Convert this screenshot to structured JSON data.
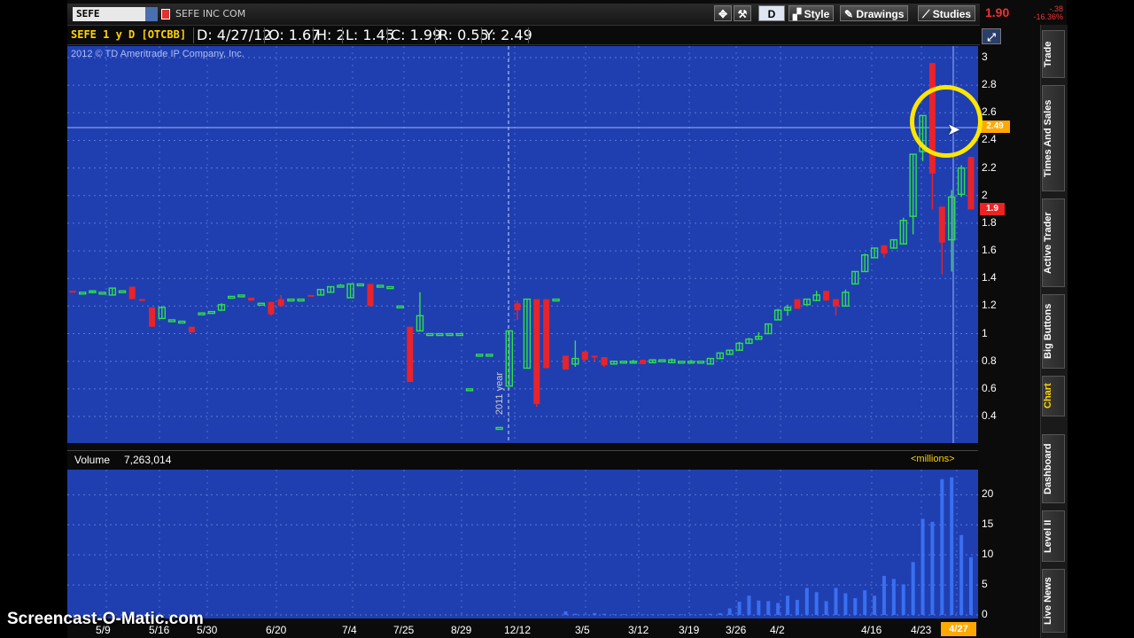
{
  "toolbar": {
    "symbol": "SEFE",
    "company": "SEFE INC COM",
    "period_button": "D",
    "style_label": "Style",
    "drawings_label": "Drawings",
    "studies_label": "Studies",
    "last_price": "1.90",
    "change_abs": "-.38",
    "change_pct": "-16.36%"
  },
  "infobar": {
    "title": "SEFE 1 y D [OTCBB]",
    "date": "D: 4/27/12",
    "open": "O: 1.67",
    "high": "H: 2",
    "low": "L: 1.45",
    "close": "C: 1.99",
    "range": "R: 0.55",
    "y": "Y: 2.49"
  },
  "copyright": "2012 © TD Ameritrade IP Company, Inc.",
  "year_marker": "2011 year",
  "price_tags": {
    "crosshair": "2.49",
    "last": "1.9"
  },
  "volume": {
    "label": "Volume",
    "value": "7,263,014",
    "units": "<millions>"
  },
  "sidebar": [
    "Trade",
    "Times And Sales",
    "Active Trader",
    "Big Buttons",
    "Chart",
    "Dashboard",
    "Level II",
    "Live News"
  ],
  "watermark": "Screencast-O-Matic.com",
  "colors": {
    "chart_bg": "#1f3fb0",
    "up": "#2fe04a",
    "down": "#e8232a",
    "accent": "#ffd400"
  },
  "chart_data": [
    {
      "type": "candlestick",
      "title": "",
      "y_ticks": [
        3,
        2.8,
        2.6,
        2.4,
        2.2,
        2,
        1.8,
        1.6,
        1.4,
        1.2,
        1,
        0.8,
        0.6,
        0.4
      ],
      "ylim": [
        0.28,
        3.08
      ],
      "x_ticks": [
        "5/9",
        "5/16",
        "5/30",
        "6/20",
        "7/4",
        "7/25",
        "8/29",
        "12/12",
        "3/5",
        "3/12",
        "3/19",
        "3/26",
        "4/2",
        "4/16",
        "4/23",
        "4/27"
      ],
      "candles": [
        {
          "o": 1.31,
          "h": 1.31,
          "l": 1.3,
          "c": 1.3
        },
        {
          "o": 1.3,
          "h": 1.3,
          "l": 1.3,
          "c": 1.3
        },
        {
          "o": 1.3,
          "h": 1.31,
          "l": 1.3,
          "c": 1.31
        },
        {
          "o": 1.3,
          "h": 1.3,
          "l": 1.3,
          "c": 1.3
        },
        {
          "o": 1.28,
          "h": 1.33,
          "l": 1.28,
          "c": 1.33
        },
        {
          "o": 1.31,
          "h": 1.31,
          "l": 1.31,
          "c": 1.31
        },
        {
          "o": 1.34,
          "h": 1.34,
          "l": 1.25,
          "c": 1.25
        },
        {
          "o": 1.25,
          "h": 1.25,
          "l": 1.24,
          "c": 1.24
        },
        {
          "o": 1.19,
          "h": 1.19,
          "l": 1.05,
          "c": 1.05
        },
        {
          "o": 1.11,
          "h": 1.2,
          "l": 1.11,
          "c": 1.19
        },
        {
          "o": 1.1,
          "h": 1.1,
          "l": 1.1,
          "c": 1.1
        },
        {
          "o": 1.09,
          "h": 1.09,
          "l": 1.09,
          "c": 1.09
        },
        {
          "o": 1.05,
          "h": 1.05,
          "l": 1.01,
          "c": 1.01
        },
        {
          "o": 1.15,
          "h": 1.15,
          "l": 1.15,
          "c": 1.15
        },
        {
          "o": 1.16,
          "h": 1.16,
          "l": 1.16,
          "c": 1.16
        },
        {
          "o": 1.17,
          "h": 1.22,
          "l": 1.17,
          "c": 1.21
        },
        {
          "o": 1.27,
          "h": 1.27,
          "l": 1.27,
          "c": 1.27
        },
        {
          "o": 1.28,
          "h": 1.28,
          "l": 1.28,
          "c": 1.28
        },
        {
          "o": 1.26,
          "h": 1.26,
          "l": 1.24,
          "c": 1.24
        },
        {
          "o": 1.22,
          "h": 1.22,
          "l": 1.22,
          "c": 1.22
        },
        {
          "o": 1.23,
          "h": 1.23,
          "l": 1.13,
          "c": 1.14
        },
        {
          "o": 1.25,
          "h": 1.28,
          "l": 1.2,
          "c": 1.2
        },
        {
          "o": 1.25,
          "h": 1.25,
          "l": 1.25,
          "c": 1.25
        },
        {
          "o": 1.25,
          "h": 1.25,
          "l": 1.25,
          "c": 1.25
        },
        {
          "o": 1.28,
          "h": 1.28,
          "l": 1.27,
          "c": 1.27
        },
        {
          "o": 1.28,
          "h": 1.32,
          "l": 1.28,
          "c": 1.32
        },
        {
          "o": 1.3,
          "h": 1.34,
          "l": 1.3,
          "c": 1.34
        },
        {
          "o": 1.35,
          "h": 1.36,
          "l": 1.35,
          "c": 1.35
        },
        {
          "o": 1.26,
          "h": 1.36,
          "l": 1.26,
          "c": 1.36
        },
        {
          "o": 1.36,
          "h": 1.36,
          "l": 1.36,
          "c": 1.36
        },
        {
          "o": 1.36,
          "h": 1.36,
          "l": 1.2,
          "c": 1.2
        },
        {
          "o": 1.35,
          "h": 1.35,
          "l": 1.35,
          "c": 1.35
        },
        {
          "o": 1.34,
          "h": 1.34,
          "l": 1.34,
          "c": 1.34
        },
        {
          "o": 1.2,
          "h": 1.2,
          "l": 1.2,
          "c": 1.2
        },
        {
          "o": 1.05,
          "h": 1.05,
          "l": 0.65,
          "c": 0.65
        },
        {
          "o": 1.02,
          "h": 1.3,
          "l": 1.02,
          "c": 1.13
        },
        {
          "o": 1.0,
          "h": 1.0,
          "l": 1.0,
          "c": 1.0
        },
        {
          "o": 1.0,
          "h": 1.0,
          "l": 1.0,
          "c": 1.0
        },
        {
          "o": 1.0,
          "h": 1.0,
          "l": 1.0,
          "c": 1.0
        },
        {
          "o": 1.0,
          "h": 1.0,
          "l": 1.0,
          "c": 1.0
        },
        {
          "o": 0.6,
          "h": 0.6,
          "l": 0.6,
          "c": 0.6
        },
        {
          "o": 0.85,
          "h": 0.85,
          "l": 0.85,
          "c": 0.85
        },
        {
          "o": 0.85,
          "h": 0.85,
          "l": 0.85,
          "c": 0.85
        },
        {
          "o": 0.32,
          "h": 0.32,
          "l": 0.32,
          "c": 0.32
        },
        {
          "o": 0.62,
          "h": 1.02,
          "l": 0.62,
          "c": 1.02
        },
        {
          "o": 1.22,
          "h": 1.24,
          "l": 1.1,
          "c": 1.17
        },
        {
          "o": 0.75,
          "h": 1.25,
          "l": 0.75,
          "c": 1.25
        },
        {
          "o": 1.25,
          "h": 1.25,
          "l": 0.47,
          "c": 0.49
        },
        {
          "o": 1.25,
          "h": 1.25,
          "l": 0.75,
          "c": 0.75
        },
        {
          "o": 1.25,
          "h": 1.25,
          "l": 1.25,
          "c": 1.25
        },
        {
          "o": 0.84,
          "h": 0.84,
          "l": 0.74,
          "c": 0.74
        },
        {
          "o": 0.78,
          "h": 0.95,
          "l": 0.76,
          "c": 0.82
        },
        {
          "o": 0.87,
          "h": 0.87,
          "l": 0.8,
          "c": 0.81
        },
        {
          "o": 0.84,
          "h": 0.84,
          "l": 0.8,
          "c": 0.83
        },
        {
          "o": 0.83,
          "h": 0.83,
          "l": 0.76,
          "c": 0.77
        },
        {
          "o": 0.78,
          "h": 0.8,
          "l": 0.78,
          "c": 0.8
        },
        {
          "o": 0.8,
          "h": 0.8,
          "l": 0.8,
          "c": 0.8
        },
        {
          "o": 0.79,
          "h": 0.81,
          "l": 0.79,
          "c": 0.8
        },
        {
          "o": 0.81,
          "h": 0.81,
          "l": 0.78,
          "c": 0.78
        },
        {
          "o": 0.79,
          "h": 0.81,
          "l": 0.79,
          "c": 0.81
        },
        {
          "o": 0.81,
          "h": 0.81,
          "l": 0.81,
          "c": 0.81
        },
        {
          "o": 0.79,
          "h": 0.82,
          "l": 0.79,
          "c": 0.81
        },
        {
          "o": 0.8,
          "h": 0.8,
          "l": 0.8,
          "c": 0.8
        },
        {
          "o": 0.79,
          "h": 0.81,
          "l": 0.79,
          "c": 0.8
        },
        {
          "o": 0.8,
          "h": 0.8,
          "l": 0.8,
          "c": 0.8
        },
        {
          "o": 0.78,
          "h": 0.82,
          "l": 0.78,
          "c": 0.82
        },
        {
          "o": 0.82,
          "h": 0.86,
          "l": 0.82,
          "c": 0.86
        },
        {
          "o": 0.85,
          "h": 0.88,
          "l": 0.85,
          "c": 0.88
        },
        {
          "o": 0.88,
          "h": 0.94,
          "l": 0.88,
          "c": 0.93
        },
        {
          "o": 0.93,
          "h": 0.97,
          "l": 0.93,
          "c": 0.96
        },
        {
          "o": 0.96,
          "h": 1.01,
          "l": 0.96,
          "c": 0.98
        },
        {
          "o": 1.0,
          "h": 1.07,
          "l": 1.0,
          "c": 1.07
        },
        {
          "o": 1.1,
          "h": 1.18,
          "l": 1.1,
          "c": 1.17
        },
        {
          "o": 1.17,
          "h": 1.21,
          "l": 1.13,
          "c": 1.19
        },
        {
          "o": 1.25,
          "h": 1.25,
          "l": 1.18,
          "c": 1.18
        },
        {
          "o": 1.21,
          "h": 1.25,
          "l": 1.21,
          "c": 1.25
        },
        {
          "o": 1.24,
          "h": 1.31,
          "l": 1.24,
          "c": 1.28
        },
        {
          "o": 1.31,
          "h": 1.31,
          "l": 1.24,
          "c": 1.24
        },
        {
          "o": 1.25,
          "h": 1.25,
          "l": 1.13,
          "c": 1.2
        },
        {
          "o": 1.2,
          "h": 1.32,
          "l": 1.2,
          "c": 1.3
        },
        {
          "o": 1.36,
          "h": 1.45,
          "l": 1.36,
          "c": 1.45
        },
        {
          "o": 1.45,
          "h": 1.58,
          "l": 1.45,
          "c": 1.57
        },
        {
          "o": 1.55,
          "h": 1.62,
          "l": 1.55,
          "c": 1.62
        },
        {
          "o": 1.64,
          "h": 1.64,
          "l": 1.55,
          "c": 1.58
        },
        {
          "o": 1.62,
          "h": 1.68,
          "l": 1.62,
          "c": 1.68
        },
        {
          "o": 1.65,
          "h": 1.84,
          "l": 1.65,
          "c": 1.82
        },
        {
          "o": 1.85,
          "h": 2.3,
          "l": 1.72,
          "c": 2.3
        },
        {
          "o": 2.32,
          "h": 2.58,
          "l": 2.25,
          "c": 2.58
        },
        {
          "o": 2.96,
          "h": 2.96,
          "l": 1.9,
          "c": 2.16
        },
        {
          "o": 1.92,
          "h": 1.92,
          "l": 1.43,
          "c": 1.66
        },
        {
          "o": 1.68,
          "h": 2.04,
          "l": 1.45,
          "c": 1.99
        },
        {
          "o": 2.01,
          "h": 2.22,
          "l": 1.99,
          "c": 2.2
        },
        {
          "o": 2.28,
          "h": 2.28,
          "l": 1.9,
          "c": 1.9
        }
      ]
    },
    {
      "type": "bar",
      "title": "Volume",
      "ylabel": "millions",
      "y_ticks": [
        20,
        15,
        10,
        5,
        0
      ],
      "ylim": [
        0,
        23
      ],
      "values": [
        0,
        0,
        0,
        0,
        0,
        0,
        0,
        0,
        0,
        0,
        0,
        0,
        0,
        0,
        0,
        0,
        0,
        0,
        0,
        0,
        0,
        0,
        0,
        0,
        0,
        0,
        0,
        0,
        0,
        0,
        0,
        0,
        0,
        0,
        0,
        0,
        0,
        0,
        0,
        0,
        0,
        0,
        0,
        0,
        0,
        0,
        0,
        0,
        0,
        0,
        0.6,
        0.2,
        0.1,
        0.3,
        0.2,
        0.1,
        0.1,
        0.1,
        0.1,
        0.1,
        0.1,
        0.1,
        0.1,
        0.1,
        0.1,
        0.2,
        0.3,
        1.1,
        2.2,
        3.2,
        2.4,
        2.3,
        2.0,
        3.2,
        2.5,
        4.5,
        3.8,
        2.3,
        4.5,
        3.6,
        2.8,
        4.1,
        3.2,
        6.5,
        6.0,
        5.1,
        8.8,
        16.0,
        15.5,
        22.6,
        22.9,
        13.3,
        9.6,
        8.0,
        10.3
      ]
    }
  ]
}
